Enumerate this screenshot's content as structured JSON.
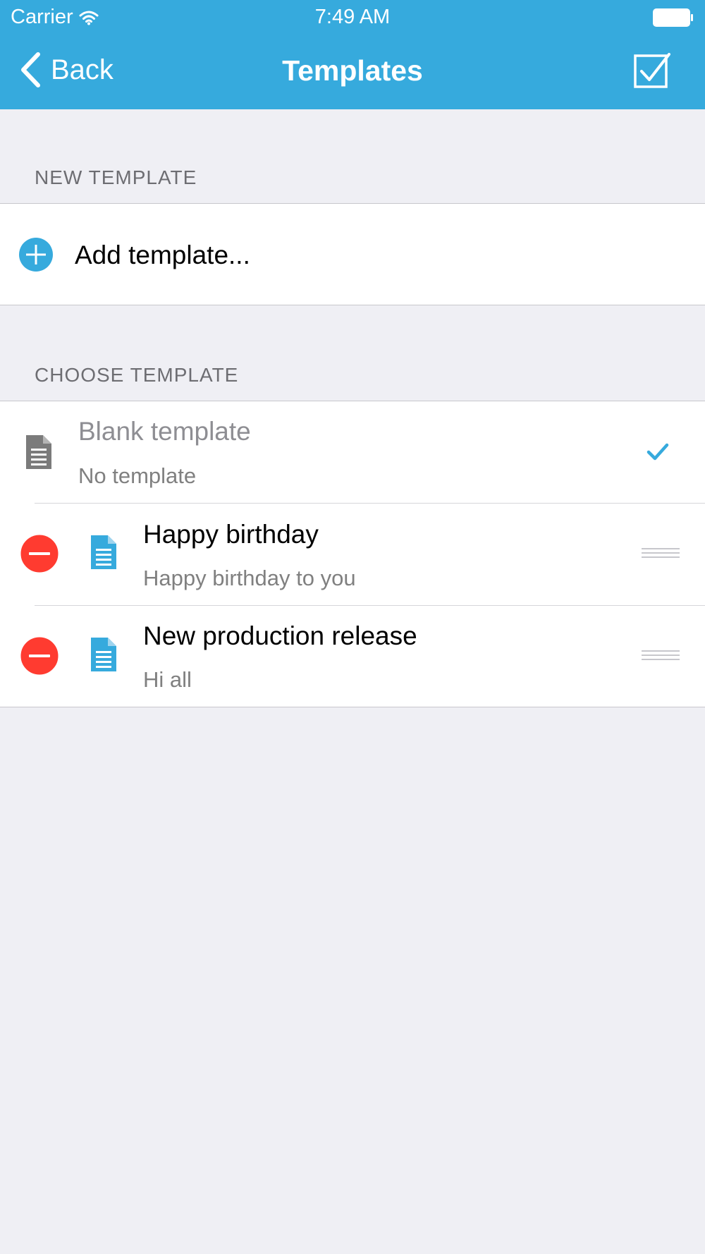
{
  "status_bar": {
    "carrier": "Carrier",
    "time": "7:49 AM"
  },
  "nav": {
    "back_label": "Back",
    "title": "Templates"
  },
  "sections": {
    "new_template": {
      "header": "NEW TEMPLATE",
      "add_label": "Add template..."
    },
    "choose_template": {
      "header": "CHOOSE TEMPLATE",
      "items": [
        {
          "title": "Blank template",
          "subtitle": "No template",
          "selected": true
        },
        {
          "title": "Happy birthday",
          "subtitle": "Happy birthday to you",
          "selected": false
        },
        {
          "title": "New production release",
          "subtitle": "Hi all",
          "selected": false
        }
      ]
    }
  },
  "colors": {
    "accent": "#36aadd",
    "delete": "#ff3b30",
    "background": "#efeff4"
  }
}
